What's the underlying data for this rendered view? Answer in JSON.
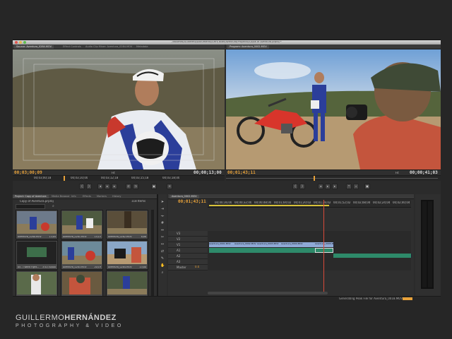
{
  "window": {
    "title": "/Volumes/Guillermo/Documents/GHH/Taller/Aventura/Proyecto/Copia of Aventura.prproj *"
  },
  "source_monitor": {
    "tabs": [
      "Source: Aventura_0284.MOV",
      "Effect Controls",
      "Audio Clip Mixer: Aventura_0284.MOV",
      "Metadata"
    ],
    "timecode_in": "00;03;00;09",
    "timecode_dur": "00;00;13;00",
    "zoom": "Fit",
    "ruler_ticks": [
      "00;03;00;18",
      "00;03;10;00",
      "00;03;12;18",
      "00;03;15;18",
      "00;03;18;00"
    ]
  },
  "program_monitor": {
    "tabs": [
      "Program: Aventura_0002.MOV"
    ],
    "timecode_in": "00;01;43;11",
    "timecode_dur": "00;00;41;03",
    "zoom": "Fit"
  },
  "project": {
    "tabs": [
      "Project: Copy of Aventura",
      "Media Browser",
      "Info",
      "Effects",
      "Markers",
      "History"
    ],
    "file": "Copy of Aventura.prproj",
    "count": "118 Items",
    "clips": [
      {
        "name": "Aventura_0280.MOV",
        "dur": "13;04"
      },
      {
        "name": "Aventura_0281.MOV",
        "dur": "15;15"
      },
      {
        "name": "Aventura_0282.MOV",
        "dur": "8;08"
      },
      {
        "name": "Aventura_0283.MOV",
        "dur": ""
      },
      {
        "name": "04 - I Want Fight...",
        "dur": "3:41:30000"
      },
      {
        "name": "Aventura_0283.MOV",
        "dur": "20;19"
      },
      {
        "name": "Aventura_0284.MOV",
        "dur": "13;00"
      },
      {
        "name": "",
        "dur": ""
      },
      {
        "name": "",
        "dur": ""
      }
    ]
  },
  "timeline": {
    "tab": "Aventura_0002.MOV",
    "timecode": "00;01;43;11",
    "ruler": [
      "00;00;16;00",
      "00;00;32;00",
      "00;00;48;00",
      "00;01;04;02",
      "00;01;20;02",
      "00;01;36;02",
      "00;01;52;02",
      "00;02;08;04",
      "00;02;24;04",
      "00;02;40;04"
    ],
    "tracks": [
      "V3",
      "V2",
      "V1",
      "A1",
      "A2",
      "A3",
      "Master"
    ],
    "master_value": "0.0",
    "video_clips": [
      "Aventura_0001.MOV",
      "Aventura_0002.MOV",
      "Aventura_0003.MOV",
      "Aventura_0004.MOV",
      "Aventura_0005.MOV"
    ]
  },
  "status": {
    "message": "Generating Peak File for Aventura_0018.MOV"
  },
  "brand": {
    "name_light": "GUILLERMO",
    "name_bold": "HERNÁNDEZ",
    "sub": "PHOTOGRAPHY & VIDEO"
  },
  "colors": {
    "timecode": "#e8a23a",
    "playhead": "#d84a3a",
    "video_clip": "#8fa9d6",
    "audio_clip": "#2e8a6a"
  }
}
